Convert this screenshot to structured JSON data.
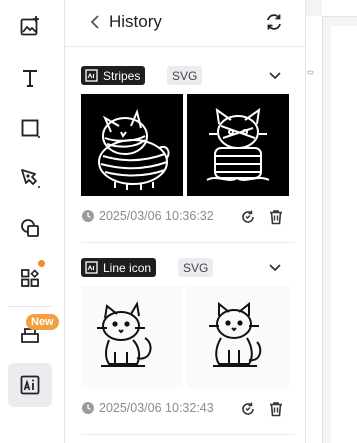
{
  "toolbar": {
    "items": [
      {
        "icon": "image-add-icon"
      },
      {
        "icon": "text-icon"
      },
      {
        "icon": "rectangle-icon"
      },
      {
        "icon": "pen-icon"
      },
      {
        "icon": "shapes-icon"
      },
      {
        "icon": "apps-icon",
        "notification_dot": true
      },
      {
        "icon": "template-box-icon",
        "badge": "New"
      },
      {
        "icon": "ai-image-icon",
        "active": true
      }
    ],
    "new_badge": "New"
  },
  "history": {
    "title": "History",
    "cards": [
      {
        "type_label": "Stripes",
        "format": "SVG",
        "timestamp": "2025/03/06 10:36:32",
        "thumbnails": [
          "striped-cat-sitting-white-on-black",
          "striped-cat-front-white-on-black"
        ]
      },
      {
        "type_label": "Line icon",
        "format": "SVG",
        "timestamp": "2025/03/06 10:32:43",
        "thumbnails": [
          "line-cat-sitting-black-on-white",
          "line-cat-sitting-front-black-on-white"
        ]
      }
    ]
  },
  "canvas": {
    "ruler_mark": "0"
  },
  "colors": {
    "accent_orange": "#f0a040",
    "tag_dark": "#1e1e1e",
    "muted_text": "#8a8a8f",
    "active_tool_bg": "#ececf0"
  }
}
